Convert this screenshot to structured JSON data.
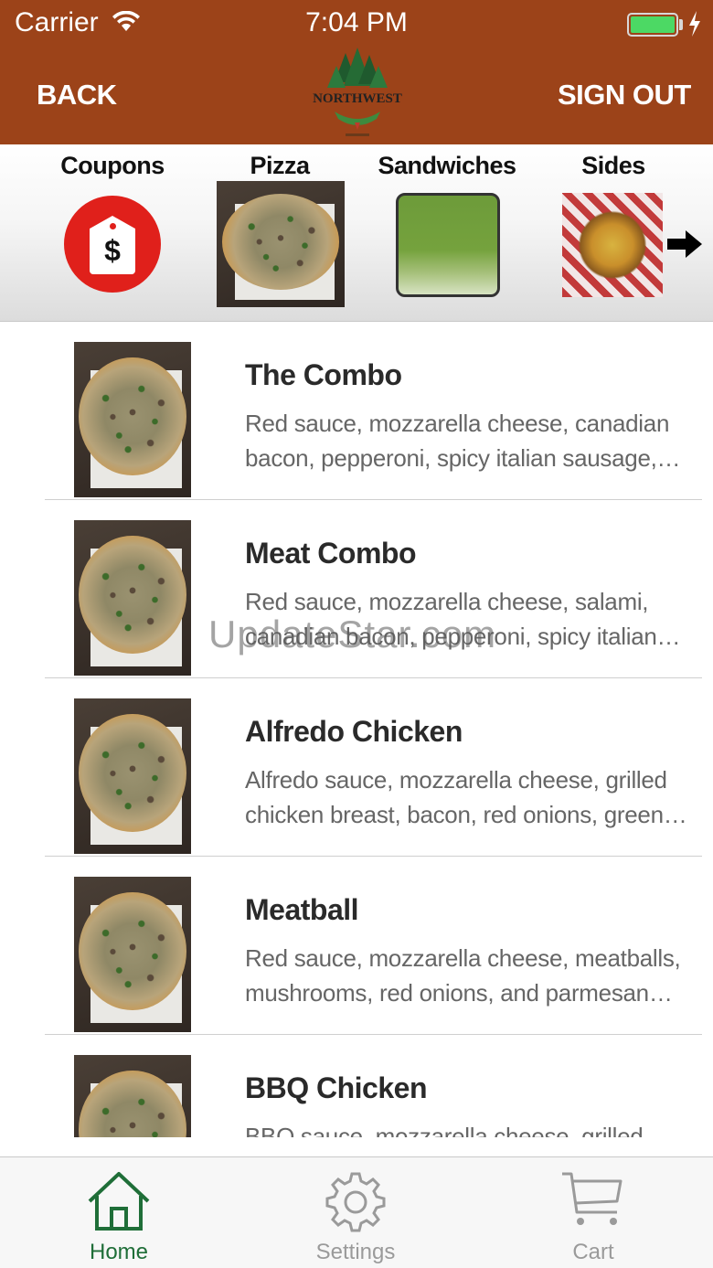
{
  "status_bar": {
    "carrier": "Carrier",
    "time": "7:04 PM",
    "battery_color": "#4cd964"
  },
  "nav": {
    "back_label": "BACK",
    "sign_out_label": "SIGN OUT",
    "logo_text": "NORTHWEST",
    "bar_color": "#9c4319"
  },
  "categories": [
    {
      "label": "Coupons",
      "icon": "price-tag-icon"
    },
    {
      "label": "Pizza",
      "icon": "pizza-image"
    },
    {
      "label": "Sandwiches",
      "icon": "sandwich-image"
    },
    {
      "label": "Sides",
      "icon": "sides-image"
    }
  ],
  "menu": {
    "items": [
      {
        "name": "The Combo",
        "description": "Red sauce, mozzarella cheese, canadian bacon, pepperoni, spicy italian sausage, mushrooms, olives"
      },
      {
        "name": "Meat Combo",
        "description": "Red sauce, mozzarella cheese, salami, canadian bacon, pepperoni, spicy italian sausage"
      },
      {
        "name": "Alfredo Chicken",
        "description": "Alfredo sauce, mozzarella cheese, grilled chicken breast, bacon, red onions, green peppers"
      },
      {
        "name": "Meatball",
        "description": "Red sauce, mozzarella cheese, meatballs, mushrooms, red onions, and parmesan cheese"
      },
      {
        "name": "BBQ Chicken",
        "description": "BBQ sauce, mozzarella cheese, grilled chicken"
      }
    ]
  },
  "watermark": "UpdateStar.com",
  "tabbar": {
    "home_label": "Home",
    "settings_label": "Settings",
    "cart_label": "Cart",
    "active_color": "#1f6e38"
  }
}
